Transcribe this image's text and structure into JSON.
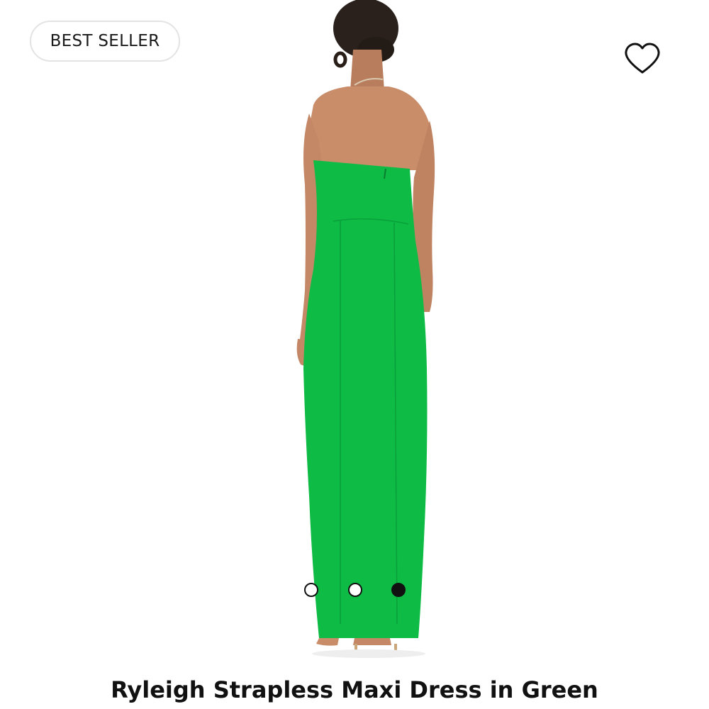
{
  "product": {
    "badge": "BEST SELLER",
    "title": "Ryleigh Strapless Maxi Dress in Green",
    "image": {
      "icon": "dress-photo",
      "dress_color": "#0dbb45",
      "skin_color": "#c98d6a",
      "hair_color": "#2a211c"
    },
    "wishlist_icon": "heart-outline-icon"
  },
  "carousel": {
    "total": 3,
    "active_index": 2
  }
}
